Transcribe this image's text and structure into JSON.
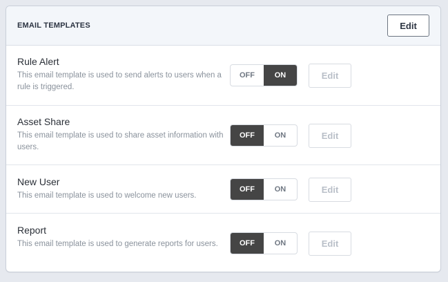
{
  "header": {
    "title": "EMAIL TEMPLATES",
    "edit_label": "Edit"
  },
  "templates": [
    {
      "title": "Rule Alert",
      "description": "This email template is used to send alerts to users when a rule is triggered.",
      "off_label": "OFF",
      "on_label": "ON",
      "state": "on",
      "edit_label": "Edit"
    },
    {
      "title": "Asset Share",
      "description": "This email template is used to share asset information with users.",
      "off_label": "OFF",
      "on_label": "ON",
      "state": "off",
      "edit_label": "Edit"
    },
    {
      "title": "New User",
      "description": "This email template is used to welcome new users.",
      "off_label": "OFF",
      "on_label": "ON",
      "state": "off",
      "edit_label": "Edit"
    },
    {
      "title": "Report",
      "description": "This email template is used to generate reports for users.",
      "off_label": "OFF",
      "on_label": "ON",
      "state": "off",
      "edit_label": "Edit"
    }
  ],
  "colors": {
    "active_toggle": "#454545",
    "header_bg": "#f3f6fa",
    "page_bg": "#e6e9ef"
  }
}
